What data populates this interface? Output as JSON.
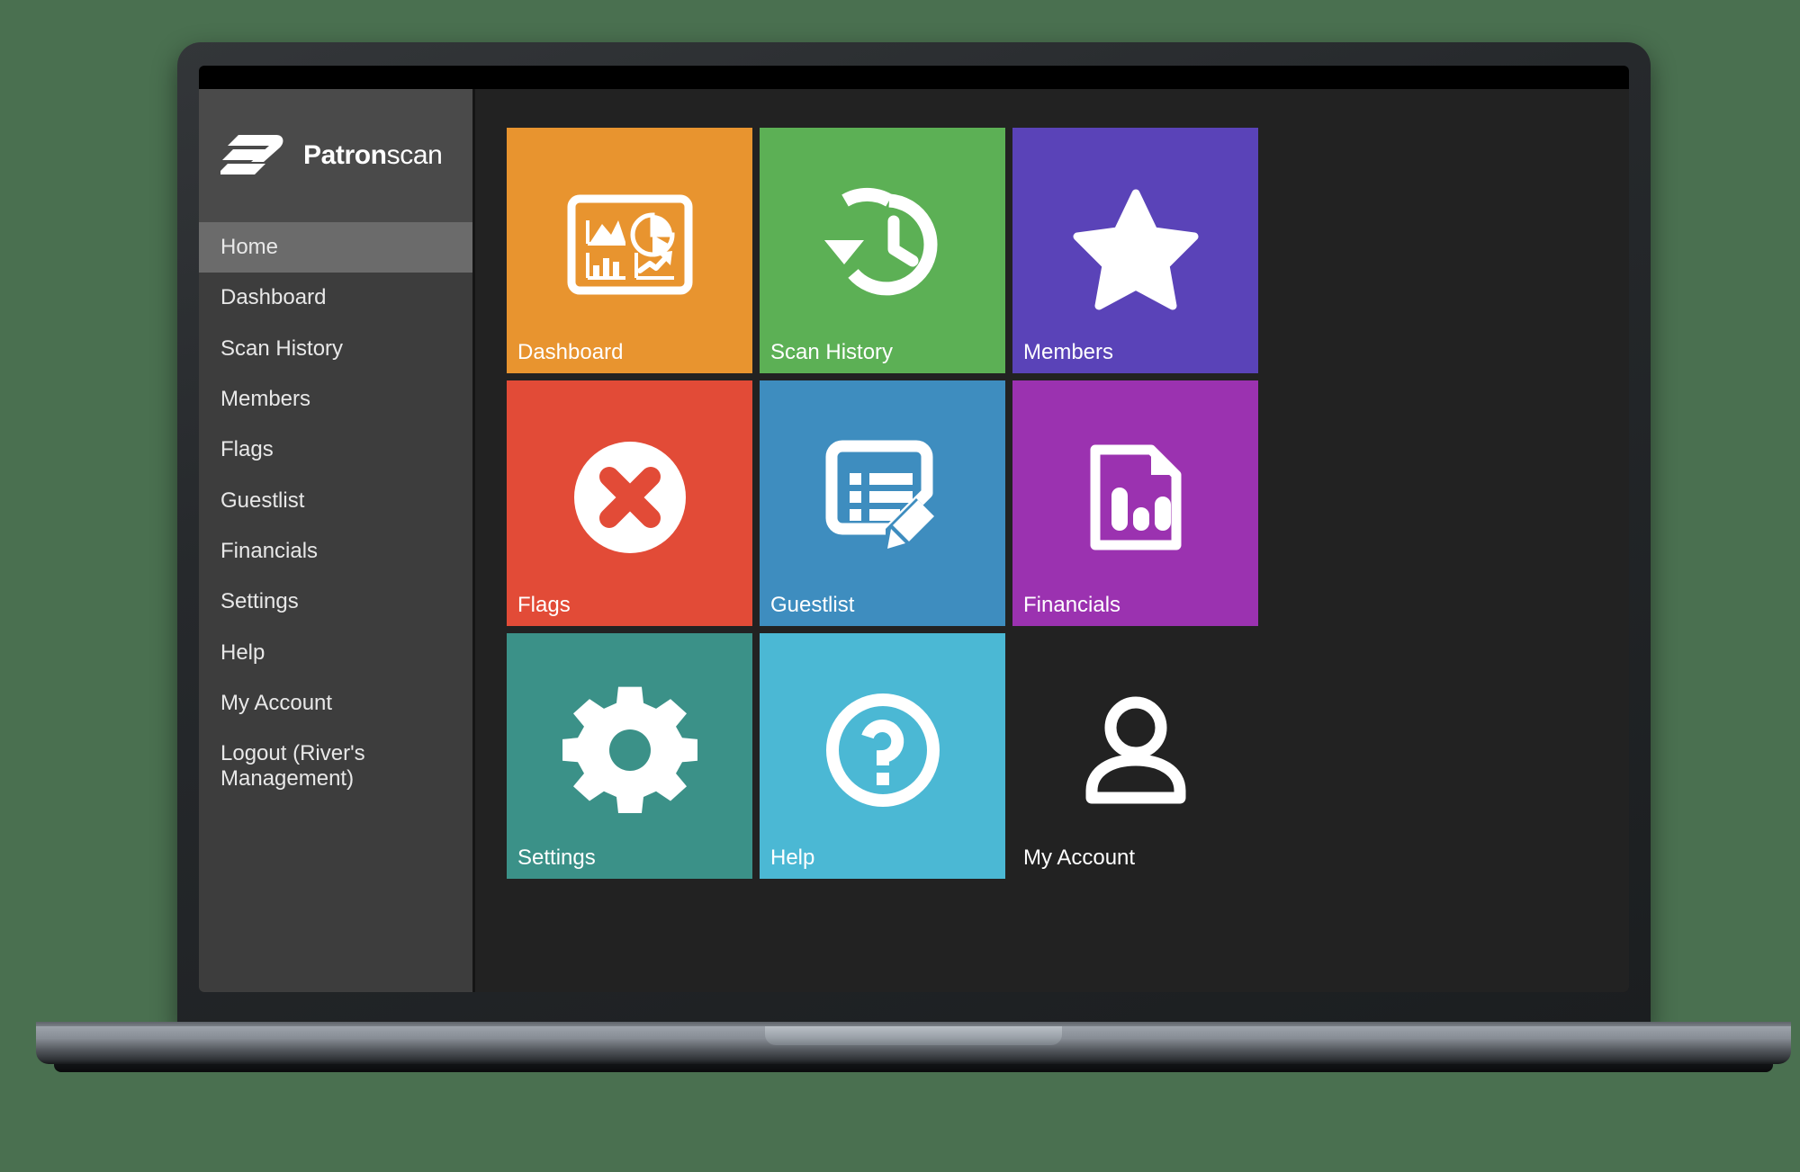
{
  "brand": {
    "name_bold": "Patron",
    "name_light": "scan",
    "logo_icon": "patronscan-logo-icon"
  },
  "sidebar": {
    "items": [
      {
        "label": "Home",
        "active": true
      },
      {
        "label": "Dashboard",
        "active": false
      },
      {
        "label": "Scan History",
        "active": false
      },
      {
        "label": "Members",
        "active": false
      },
      {
        "label": "Flags",
        "active": false
      },
      {
        "label": "Guestlist",
        "active": false
      },
      {
        "label": "Financials",
        "active": false
      },
      {
        "label": "Settings",
        "active": false
      },
      {
        "label": "Help",
        "active": false
      },
      {
        "label": "My Account",
        "active": false
      },
      {
        "label": "Logout (River's Management)",
        "active": false
      }
    ]
  },
  "tiles": [
    {
      "label": "Dashboard",
      "color": "#e8942f",
      "icon": "dashboard-charts-icon"
    },
    {
      "label": "Scan History",
      "color": "#5cb055",
      "icon": "history-clock-icon"
    },
    {
      "label": "Members",
      "color": "#5a43b8",
      "icon": "star-icon"
    },
    {
      "label": "Flags",
      "color": "#e24b37",
      "icon": "circle-x-icon"
    },
    {
      "label": "Guestlist",
      "color": "#3e8dbf",
      "icon": "list-pencil-icon"
    },
    {
      "label": "Financials",
      "color": "#9b32b0",
      "icon": "document-bar-chart-icon"
    },
    {
      "label": "Settings",
      "color": "#3b9188",
      "icon": "gear-icon"
    },
    {
      "label": "Help",
      "color": "#4bb8d4",
      "icon": "question-circle-icon"
    },
    {
      "label": "My Account",
      "color": "transparent",
      "icon": "person-icon"
    }
  ],
  "colors": {
    "page_background": "#4a7050",
    "screen_background": "#222222",
    "sidebar_background": "#3d3d3d",
    "sidebar_active": "#6b6b6b",
    "brand_background": "#4a4a4a"
  }
}
